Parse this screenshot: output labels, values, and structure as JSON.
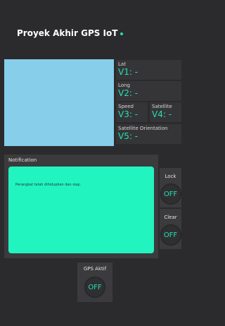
{
  "header": {
    "title": "Proyek Akhir GPS IoT"
  },
  "widgets": {
    "lat": {
      "label": "Lat",
      "value": "V1: -"
    },
    "long": {
      "label": "Long",
      "value": "V2: -"
    },
    "speed": {
      "label": "Speed",
      "value": "V3: -"
    },
    "satellite": {
      "label": "Satellite",
      "value": "V4: -"
    },
    "orientation": {
      "label": "Satellite Orientation",
      "value": "V5: -"
    }
  },
  "notification": {
    "title": "Notification",
    "message": "Perangkat telah dihidupkan dan siap."
  },
  "buttons": {
    "lock": {
      "label": "Lock",
      "state": "OFF"
    },
    "clear": {
      "label": "Clear",
      "state": "OFF"
    },
    "gps": {
      "label": "GPS Aktif",
      "state": "OFF"
    }
  },
  "colors": {
    "background": "#2b2b2d",
    "accent": "#22e0b4",
    "notification_bg": "#22f4c0",
    "map_bg": "#87ceeb"
  }
}
